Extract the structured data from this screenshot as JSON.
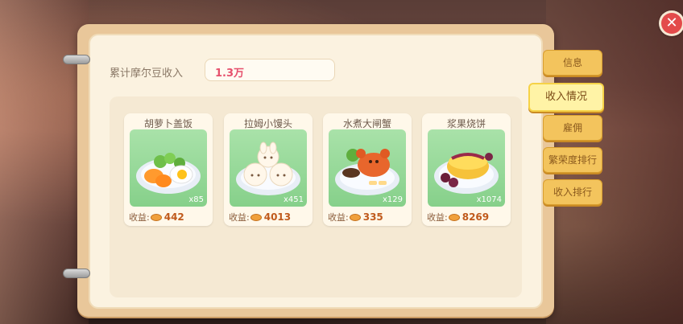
{
  "summary": {
    "label": "累计摩尔豆收入",
    "value": "1.3万"
  },
  "earnings_prefix": "收益:",
  "dishes": [
    {
      "name": "胡萝卜盖饭",
      "quantity": "x85",
      "earnings": "442"
    },
    {
      "name": "拉姆小馒头",
      "quantity": "x451",
      "earnings": "4013"
    },
    {
      "name": "水煮大闸蟹",
      "quantity": "x129",
      "earnings": "335"
    },
    {
      "name": "浆果烧饼",
      "quantity": "x1074",
      "earnings": "8269"
    }
  ],
  "tabs": [
    {
      "label": "信息"
    },
    {
      "label": "收入情况"
    },
    {
      "label": "雇佣"
    },
    {
      "label": "繁荣度排行"
    },
    {
      "label": "收入排行"
    }
  ],
  "close_icon": "close-icon",
  "colors": {
    "accent_value": "#e6506c",
    "tab": "#f3c45d",
    "tab_active": "#fff3a6",
    "card_bg": "#86d08a"
  }
}
